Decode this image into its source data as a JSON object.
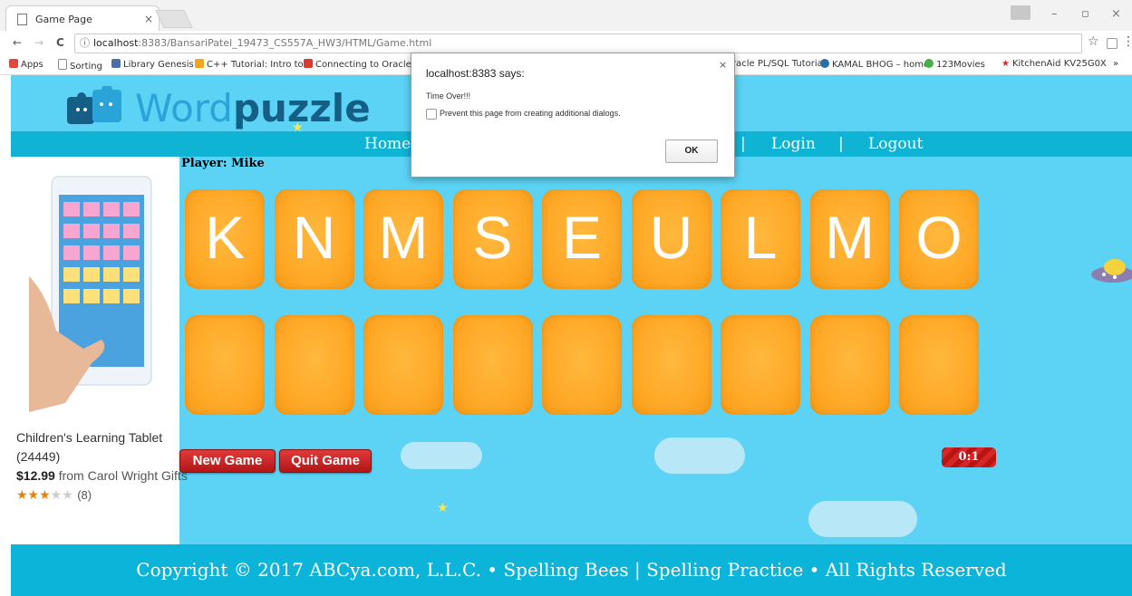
{
  "browser": {
    "tab_title": "Game Page",
    "tab_close": "×",
    "window_min": "–",
    "window_max": "▫",
    "window_close": "×",
    "nav_back": "←",
    "nav_forward": "→",
    "nav_reload": "C",
    "info_icon": "ⓘ",
    "url_host": "localhost",
    "url_path": ":8383/BansariPatel_19473_CS557A_HW3/HTML/Game.html",
    "star_icon": "☆",
    "menu_icon": "⋮",
    "bookmarks": [
      {
        "label": "Apps",
        "color": "#e04a3a"
      },
      {
        "label": "Sorting",
        "color": "#888888"
      },
      {
        "label": "Library Genesis",
        "color": "#4b6ea8"
      },
      {
        "label": "C++ Tutorial: Intro to",
        "color": "#f2a41c"
      },
      {
        "label": "Connecting to Oracle",
        "color": "#d83b30"
      },
      {
        "label": "racle PL/SQL Tutoria",
        "color": "#ffffff"
      },
      {
        "label": "KAMAL BHOG – home",
        "color": "#2a6fa8"
      },
      {
        "label": "123Movies",
        "color": "#48b04b"
      },
      {
        "label": "KitchenAid KV25G0X",
        "color": "#d8262c"
      }
    ],
    "bookmarks_more": "»"
  },
  "site": {
    "logo_word_1": "Word",
    "logo_word_2": "puzzle",
    "nav": {
      "home": "Home",
      "sep1": "|",
      "login": "Login",
      "sep2": "|",
      "logout": "Logout"
    }
  },
  "ad": {
    "title": "Children's Learning Tablet (24449)",
    "price": "$12.99",
    "seller": "from Carol Wright Gifts",
    "stars_on": "★★★",
    "stars_off": "★★",
    "review_count": "(8)",
    "rating": 3
  },
  "game": {
    "player_label": "Player: Mike",
    "letters": [
      "K",
      "N",
      "M",
      "S",
      "E",
      "U",
      "L",
      "M",
      "O"
    ],
    "answer_slots": [
      "",
      "",
      "",
      "",
      "",
      "",
      "",
      "",
      ""
    ],
    "new_game": "New Game",
    "quit_game": "Quit Game",
    "timer": "0:1"
  },
  "footer": {
    "text": "Copyright © 2017 ABCya.com, L.L.C. • Spelling Bees | Spelling Practice • All Rights Reserved"
  },
  "dialog": {
    "title": "localhost:8383 says:",
    "close": "×",
    "message": "Time Over!!!",
    "checkbox_label": "Prevent this page from creating additional dialogs.",
    "ok": "OK"
  },
  "colors": {
    "page_bg": "#5cd3f5",
    "navbar": "#0fb3d4",
    "tile": "#ffa928",
    "button_red": "#c81e1e"
  }
}
